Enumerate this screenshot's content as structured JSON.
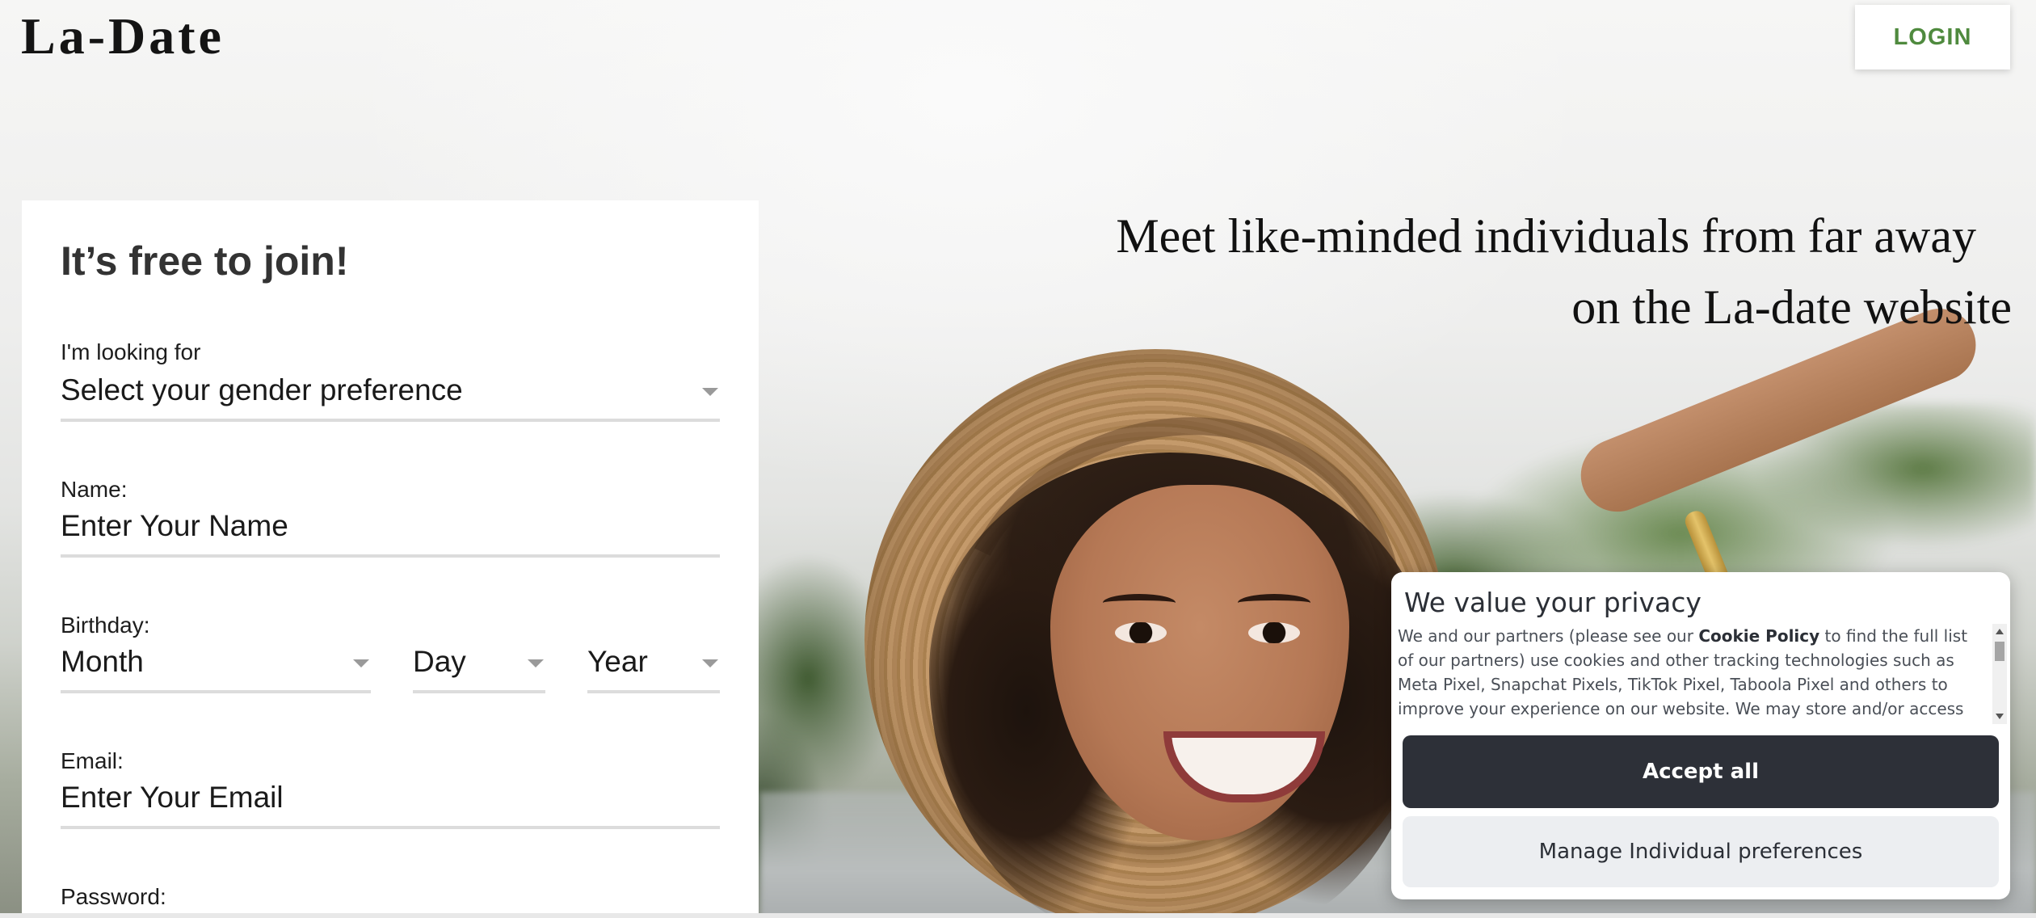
{
  "header": {
    "logo": "La-Date",
    "login_label": "LOGIN"
  },
  "hero": {
    "headline_line1": "Meet like-minded individuals from far away",
    "headline_line2": "on the La-date website"
  },
  "signup": {
    "title": "It’s free to join!",
    "looking_for": {
      "label": "I'm looking for",
      "value": "Select your gender preference"
    },
    "name": {
      "label": "Name:",
      "placeholder": "Enter Your Name"
    },
    "birthday": {
      "label": "Birthday:",
      "month": "Month",
      "day": "Day",
      "year": "Year"
    },
    "email": {
      "label": "Email:",
      "placeholder": "Enter Your Email"
    },
    "password": {
      "label": "Password:"
    }
  },
  "cookie": {
    "title": "We value your privacy",
    "body_before": "We and our partners (please see our ",
    "body_link": "Cookie Policy",
    "body_after": " to find the full list of our partners) use cookies and other tracking technologies such as Meta Pixel, Snapchat Pixels, TikTok Pixel, Taboola Pixel and others to improve your experience on our website. We may store and/or access information on a device and process",
    "accept_label": "Accept all",
    "manage_label": "Manage Individual preferences"
  },
  "colors": {
    "login_text": "#4f8a3e",
    "accept_bg": "#2d3038",
    "manage_bg": "#eceef1"
  }
}
